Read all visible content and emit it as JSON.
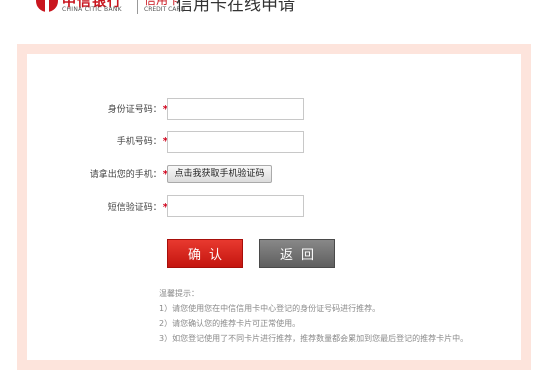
{
  "header": {
    "bank_name_cn": "中信银行",
    "bank_name_en": "CHINA CITIC BANK",
    "card_center_cn": "信用卡",
    "card_center_en": "CREDIT CARD",
    "page_title": "信用卡在线申请"
  },
  "form": {
    "id_label": "身份证号码：",
    "phone_label": "手机号码：",
    "verify_phone_label": "请拿出您的手机：",
    "sms_button": "点击我获取手机验证码",
    "sms_code_label": "短信验证码：",
    "required_mark": "*",
    "id_value": "",
    "phone_value": "",
    "sms_code_value": ""
  },
  "buttons": {
    "confirm": "确认",
    "back": "返回"
  },
  "tips": {
    "title": "温馨提示：",
    "items": [
      "1）请您使用您在中信信用卡中心登记的身份证号码进行推荐。",
      "2）请您确认您的推荐卡片可正常使用。",
      "3）如您登记使用了不同卡片进行推荐，推荐数量都会累加到您最后登记的推荐卡片中。"
    ]
  },
  "colors": {
    "brand_red": "#c9151e",
    "panel_border": "#fde4dc",
    "confirm_button": "#d42a22",
    "back_button": "#6e6e6e",
    "required_star": "#d0021b"
  }
}
